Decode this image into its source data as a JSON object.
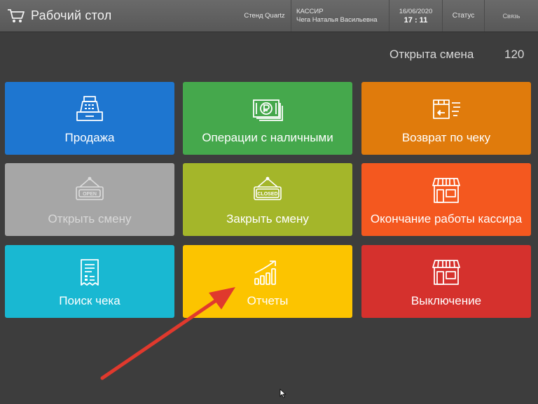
{
  "topbar": {
    "title": "Рабочий стол",
    "stand": "Стенд Quartz",
    "role": "КАССИР",
    "cashier_name": "Чега Наталья Васильевна",
    "date": "16/06/2020",
    "time": "17 : 11",
    "status": "Статус",
    "link": "Связь"
  },
  "shift": {
    "label": "Открыта смена",
    "number": "120"
  },
  "tiles": [
    {
      "label": "Продажа",
      "color": "#1e76d0",
      "icon": "cash-register-icon"
    },
    {
      "label": "Операции с наличными",
      "color": "#45a84c",
      "icon": "banknotes-icon"
    },
    {
      "label": "Возврат по чеку",
      "color": "#e07b0c",
      "icon": "return-box-icon"
    },
    {
      "label": "Открыть смену",
      "color": "#a6a6a6",
      "icon": "open-sign-icon",
      "disabled": true
    },
    {
      "label": "Закрыть смену",
      "color": "#a4b62a",
      "icon": "closed-sign-icon"
    },
    {
      "label": "Окончание работы кассира",
      "color": "#f4581f",
      "icon": "shop-icon"
    },
    {
      "label": "Поиск чека",
      "color": "#19b8d2",
      "icon": "receipt-icon"
    },
    {
      "label": "Отчеты",
      "color": "#fcc400",
      "icon": "growth-chart-icon"
    },
    {
      "label": "Выключение",
      "color": "#d5312d",
      "icon": "shop-icon"
    }
  ],
  "signs": {
    "open": "OPEN",
    "closed": "CLOSED"
  },
  "annotation_color": "#e0392d"
}
